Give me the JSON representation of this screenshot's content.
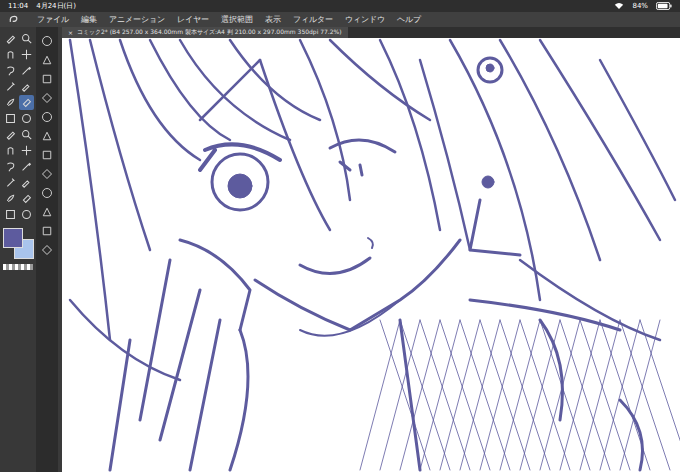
{
  "status_bar": {
    "time": "11:04",
    "date": "4月24日(日)",
    "battery": "84%"
  },
  "menu": {
    "items": [
      "ファイル",
      "編集",
      "アニメーション",
      "レイヤー",
      "選択範囲",
      "表示",
      "フィルター",
      "ウィンドウ",
      "ヘルプ"
    ]
  },
  "canvas_tab": {
    "close": "×",
    "title": "コミック2* (B4 257.00 x 364.00mm 製本サイズ:A4 判 210.00 x 297.00mm 350dpi 77.2%)"
  },
  "tools": [
    {
      "selected": false
    },
    {
      "selected": false
    },
    {
      "selected": false
    },
    {
      "selected": false
    },
    {
      "selected": false
    },
    {
      "selected": false
    },
    {
      "selected": false
    },
    {
      "selected": false
    },
    {
      "selected": false
    },
    {
      "selected": true
    },
    {
      "selected": false
    },
    {
      "selected": false
    },
    {
      "selected": false
    },
    {
      "selected": false
    },
    {
      "selected": false
    },
    {
      "selected": false
    },
    {
      "selected": false
    },
    {
      "selected": false
    },
    {
      "selected": false
    },
    {
      "selected": false
    },
    {
      "selected": false
    },
    {
      "selected": false
    },
    {
      "selected": false
    },
    {
      "selected": false
    }
  ],
  "sub_tools": [
    {
      "selected": false
    },
    {
      "selected": false
    },
    {
      "selected": false
    },
    {
      "selected": false
    },
    {
      "selected": false
    },
    {
      "selected": false
    },
    {
      "selected": false
    },
    {
      "selected": false
    },
    {
      "selected": false
    },
    {
      "selected": false
    },
    {
      "selected": false
    },
    {
      "selected": false
    }
  ],
  "colors": {
    "main": "#5d5b9e",
    "sub": "#a9c4ec"
  }
}
